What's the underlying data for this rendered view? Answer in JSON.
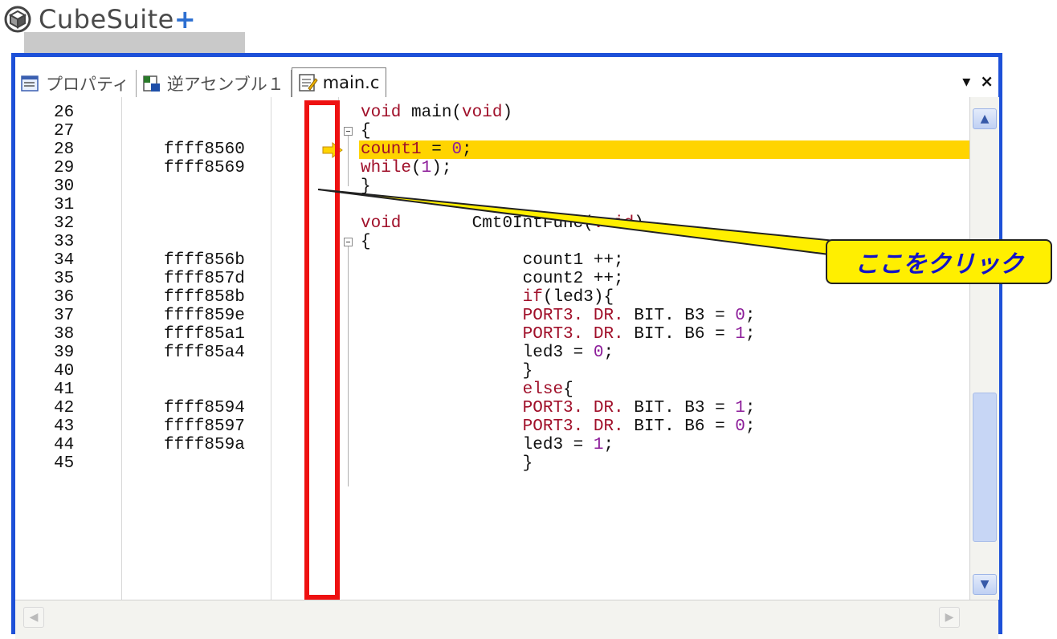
{
  "logo": {
    "text": "CubeSuite",
    "plus": "+"
  },
  "tabs": [
    {
      "label": "プロパティ",
      "icon": "properties-icon"
    },
    {
      "label": "逆アセンブル１",
      "icon": "disassemble-icon"
    },
    {
      "label": "main.c",
      "icon": "source-file-icon",
      "active": true
    }
  ],
  "tab_controls": {
    "menu": "▾",
    "close": "×"
  },
  "annotation": {
    "callout": "ここをクリック"
  },
  "editor": {
    "current_line": 28,
    "rows": [
      {
        "line": "26",
        "addr": "",
        "code": [
          [
            "kw",
            "void"
          ],
          [
            "t",
            " main("
          ],
          [
            "kw",
            "void"
          ],
          [
            "t",
            ")"
          ]
        ]
      },
      {
        "line": "27",
        "addr": "",
        "code": [
          [
            "t",
            "{"
          ]
        ]
      },
      {
        "line": "28",
        "addr": "ffff8560",
        "code": [
          [
            "kw",
            "count1"
          ],
          [
            "t",
            " = "
          ],
          [
            "num",
            "0"
          ],
          [
            "t",
            ";"
          ]
        ]
      },
      {
        "line": "29",
        "addr": "ffff8569",
        "code": [
          [
            "kw",
            "while"
          ],
          [
            "t",
            "("
          ],
          [
            "num",
            "1"
          ],
          [
            "t",
            ");"
          ]
        ]
      },
      {
        "line": "30",
        "addr": "",
        "code": [
          [
            "t",
            "}"
          ]
        ]
      },
      {
        "line": "31",
        "addr": "",
        "code": []
      },
      {
        "line": "32",
        "addr": "",
        "code": [
          [
            "kw",
            "void"
          ],
          [
            "t",
            "       Cmt0IntFunc("
          ],
          [
            "kw",
            "void"
          ],
          [
            "t",
            ")"
          ]
        ]
      },
      {
        "line": "33",
        "addr": "",
        "code": [
          [
            "t",
            "{"
          ]
        ]
      },
      {
        "line": "34",
        "addr": "ffff856b",
        "code": [
          [
            "t",
            "                count1 ++;"
          ]
        ]
      },
      {
        "line": "35",
        "addr": "ffff857d",
        "code": [
          [
            "t",
            "                count2 ++;"
          ]
        ]
      },
      {
        "line": "36",
        "addr": "ffff858b",
        "code": [
          [
            "t",
            "                "
          ],
          [
            "kw",
            "if"
          ],
          [
            "t",
            "(led3){"
          ]
        ]
      },
      {
        "line": "37",
        "addr": "ffff859e",
        "code": [
          [
            "t",
            "                "
          ],
          [
            "kw",
            "PORT3. DR."
          ],
          [
            "t",
            " BIT. B3 = "
          ],
          [
            "num",
            "0"
          ],
          [
            "t",
            ";"
          ]
        ]
      },
      {
        "line": "38",
        "addr": "ffff85a1",
        "code": [
          [
            "t",
            "                "
          ],
          [
            "kw",
            "PORT3. DR."
          ],
          [
            "t",
            " BIT. B6 = "
          ],
          [
            "num",
            "1"
          ],
          [
            "t",
            ";"
          ]
        ]
      },
      {
        "line": "39",
        "addr": "ffff85a4",
        "code": [
          [
            "t",
            "                led3 = "
          ],
          [
            "num",
            "0"
          ],
          [
            "t",
            ";"
          ]
        ]
      },
      {
        "line": "40",
        "addr": "",
        "code": [
          [
            "t",
            "                }"
          ]
        ]
      },
      {
        "line": "41",
        "addr": "",
        "code": [
          [
            "t",
            "                "
          ],
          [
            "kw",
            "else"
          ],
          [
            "t",
            "{"
          ]
        ]
      },
      {
        "line": "42",
        "addr": "ffff8594",
        "code": [
          [
            "t",
            "                "
          ],
          [
            "kw",
            "PORT3. DR."
          ],
          [
            "t",
            " BIT. B3 = "
          ],
          [
            "num",
            "1"
          ],
          [
            "t",
            ";"
          ]
        ]
      },
      {
        "line": "43",
        "addr": "ffff8597",
        "code": [
          [
            "t",
            "                "
          ],
          [
            "kw",
            "PORT3. DR."
          ],
          [
            "t",
            " BIT. B6 = "
          ],
          [
            "num",
            "0"
          ],
          [
            "t",
            ";"
          ]
        ]
      },
      {
        "line": "44",
        "addr": "ffff859a",
        "code": [
          [
            "t",
            "                led3 = "
          ],
          [
            "num",
            "1"
          ],
          [
            "t",
            ";"
          ]
        ]
      },
      {
        "line": "45",
        "addr": "",
        "code": [
          [
            "t",
            "                }"
          ]
        ]
      }
    ]
  },
  "colors": {
    "window_border": "#1d50d8",
    "highlight": "#ffd400",
    "keyword": "#a0102a",
    "number": "#8d1e9a",
    "red_box": "#ee1111",
    "callout_bg": "#ffef00",
    "callout_text": "#1212c8"
  }
}
